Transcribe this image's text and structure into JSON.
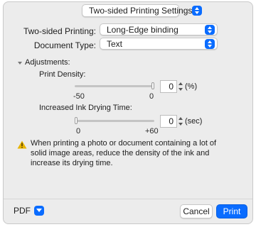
{
  "header": {
    "settings_popup": "Two-sided Printing Settings"
  },
  "form": {
    "two_sided_label": "Two-sided Printing:",
    "two_sided_value": "Long-Edge binding",
    "doc_type_label": "Document Type:",
    "doc_type_value": "Text"
  },
  "adjustments": {
    "title": "Adjustments:",
    "print_density": {
      "label": "Print Density:",
      "value": "0",
      "unit": "(%)",
      "min_label": "-50",
      "max_label": "0",
      "level": 1.0
    },
    "drying_time": {
      "label": "Increased Ink Drying Time:",
      "value": "0",
      "unit": "(sec)",
      "min_label": "0",
      "max_label": "+60",
      "level": 0.0
    },
    "warning": "When printing a photo or document containing a lot of solid image areas, reduce the density of the ink and increase its drying time."
  },
  "footer": {
    "pdf_label": "PDF",
    "cancel_label": "Cancel",
    "print_label": "Print"
  },
  "colors": {
    "accent": "#0a6cff",
    "warning": "#e8b400"
  },
  "icons": [
    "chevron-updown-icon",
    "disclosure-triangle-icon",
    "warning-icon",
    "chevron-down-icon"
  ]
}
